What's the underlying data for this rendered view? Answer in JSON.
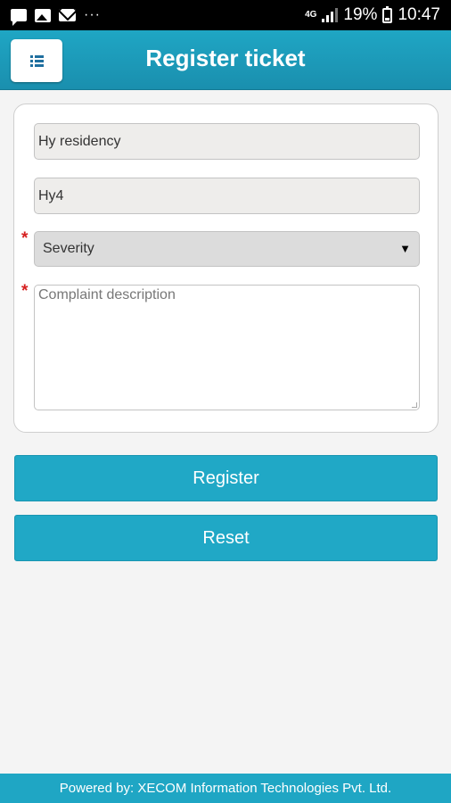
{
  "status_bar": {
    "network_label": "4G",
    "battery_percent": "19%",
    "time": "10:47",
    "notification_icons": [
      "chat-icon",
      "image-icon",
      "mail-icon",
      "more-dots-icon"
    ],
    "overflow_dots": "···"
  },
  "header": {
    "title": "Register ticket",
    "menu_icon": "list-icon"
  },
  "form": {
    "property_value": "Hy residency",
    "unit_value": "Hy4",
    "severity": {
      "selected": "Severity",
      "caret": "▼"
    },
    "description_placeholder": "Complaint description",
    "required_marker": "*"
  },
  "actions": {
    "register_label": "Register",
    "reset_label": "Reset"
  },
  "footer": {
    "text": "Powered by: XECOM Information Technologies Pvt. Ltd."
  },
  "colors": {
    "accent": "#20a8c6",
    "required": "#d62020"
  }
}
